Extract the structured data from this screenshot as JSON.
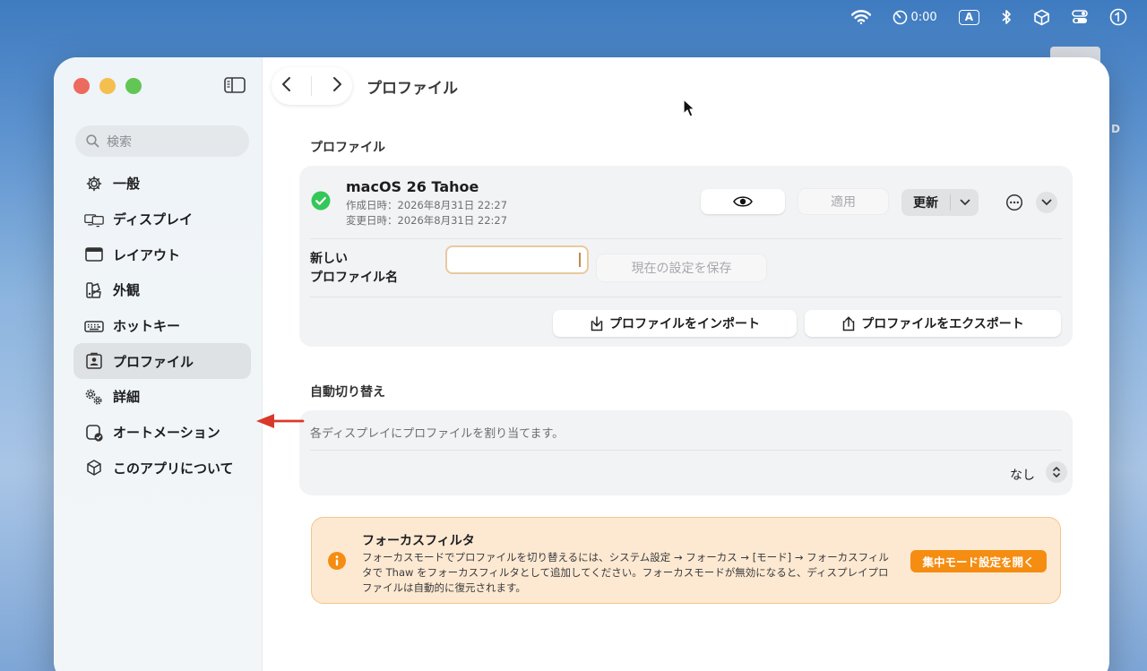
{
  "menubar": {
    "timer": "0:00",
    "input_source": "A"
  },
  "sidebar": {
    "search_placeholder": "検索",
    "items": [
      {
        "label": "一般",
        "icon": "gear-icon"
      },
      {
        "label": "ディスプレイ",
        "icon": "displays-icon"
      },
      {
        "label": "レイアウト",
        "icon": "layout-icon"
      },
      {
        "label": "外観",
        "icon": "appearance-icon"
      },
      {
        "label": "ホットキー",
        "icon": "keyboard-icon"
      },
      {
        "label": "プロファイル",
        "icon": "profile-icon",
        "active": true
      },
      {
        "label": "詳細",
        "icon": "advanced-gears-icon"
      },
      {
        "label": "オートメーション",
        "icon": "automation-icon"
      },
      {
        "label": "このアプリについて",
        "icon": "cube-icon"
      }
    ]
  },
  "header": {
    "title": "プロファイル"
  },
  "profile_section": {
    "title": "プロファイル",
    "profile": {
      "name": "macOS 26 Tahoe",
      "created": "作成日時：2026年8月31日 22:27",
      "modified": "変更日時：2026年8月31日 22:27"
    },
    "apply_label": "適用",
    "update_label": "更新",
    "new_name_label_line1": "新しい",
    "new_name_label_line2": "プロファイル名",
    "new_name_value": "",
    "save_current_label": "現在の設定を保存",
    "import_label": "プロファイルをインポート",
    "export_label": "プロファイルをエクスポート"
  },
  "auto_switch": {
    "title": "自動切り替え",
    "description": "各ディスプレイにプロファイルを割り当てます。",
    "value": "なし"
  },
  "focus_filter": {
    "title": "フォーカスフィルタ",
    "body": "フォーカスモードでプロファイルを切り替えるには、システム設定 → フォーカス → [モード] → フォーカスフィルタで Thaw をフォーカスフィルタとして追加してください。フォーカスモードが無効になると、ディスプレイプロファイルは自動的に復元されます。",
    "button_label": "集中モード設定を開く"
  },
  "colors": {
    "accent_orange": "#f58d12",
    "focus_background": "#fde9d2",
    "annotation_arrow": "#d9392b",
    "check_green": "#34c759"
  }
}
